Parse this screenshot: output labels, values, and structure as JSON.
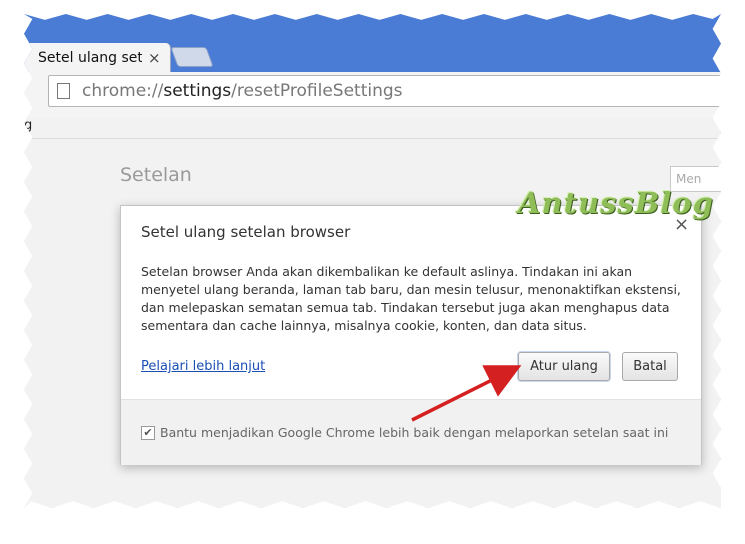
{
  "tab": {
    "title": "Setel ulang setelan",
    "close_glyph": "×"
  },
  "omnibox": {
    "scheme": "chrome://",
    "host": "settings",
    "path": "/resetProfileSettings"
  },
  "bookmark_stub": "g",
  "page": {
    "title": "Setelan",
    "search_placeholder": "Men"
  },
  "watermark": "AntussBlog",
  "dialog": {
    "title": "Setel ulang setelan browser",
    "close_glyph": "×",
    "body": "Setelan browser Anda akan dikembalikan ke default aslinya. Tindakan ini akan menyetel ulang beranda, laman tab baru, dan mesin telusur, menonaktifkan ekstensi, dan melepaskan sematan semua tab. Tindakan tersebut juga akan menghapus data sementara dan cache lainnya, misalnya cookie, konten, dan data situs.",
    "learn_more": "Pelajari lebih lanjut",
    "reset_button": "Atur ulang",
    "cancel_button": "Batal",
    "checkbox_checked": true,
    "checkbox_glyph": "✔",
    "checkbox_label": "Bantu menjadikan Google Chrome lebih baik dengan melaporkan setelan saat ini"
  },
  "colors": {
    "titlebar": "#4a7cd6",
    "arrow": "#d42020",
    "watermark": "#8fbe59",
    "link": "#1a4fb5"
  }
}
